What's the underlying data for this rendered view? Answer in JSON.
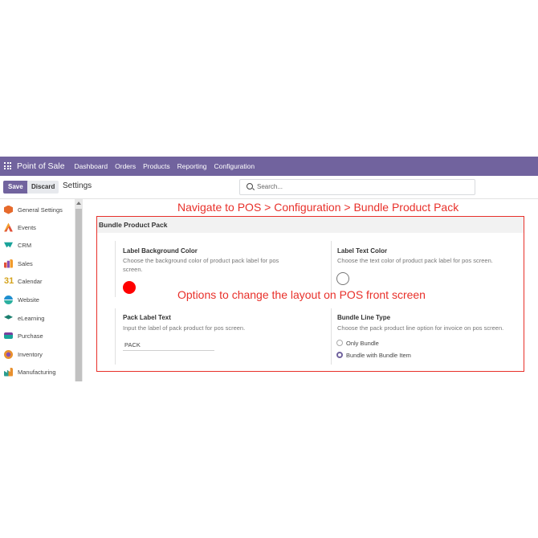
{
  "topnav": {
    "app_name": "Point of Sale",
    "items": [
      "Dashboard",
      "Orders",
      "Products",
      "Reporting",
      "Configuration"
    ],
    "color": "#71639e"
  },
  "control_panel": {
    "save_label": "Save",
    "discard_label": "Discard",
    "title": "Settings",
    "search_placeholder": "Search..."
  },
  "sidebar": {
    "items": [
      {
        "label": "General Settings",
        "icon": "gear-cube-icon",
        "color": "#e66a2c"
      },
      {
        "label": "Events",
        "icon": "events-icon",
        "color": "#f29b2c"
      },
      {
        "label": "CRM",
        "icon": "crm-handshake-icon",
        "color": "#1aa39a"
      },
      {
        "label": "Sales",
        "icon": "sales-chart-icon",
        "color": "#8a4fb5"
      },
      {
        "label": "Calendar",
        "icon": "calendar-31-icon",
        "color": "#d4a21a"
      },
      {
        "label": "Website",
        "icon": "website-globe-icon",
        "color": "#1f8fcf"
      },
      {
        "label": "eLearning",
        "icon": "elearning-cap-icon",
        "color": "#1b7f6e"
      },
      {
        "label": "Purchase",
        "icon": "purchase-card-icon",
        "color": "#7a3e9d"
      },
      {
        "label": "Inventory",
        "icon": "inventory-box-icon",
        "color": "#e8902e"
      },
      {
        "label": "Manufacturing",
        "icon": "manufacturing-icon",
        "color": "#2a9d8f"
      }
    ]
  },
  "section": {
    "title": "Bundle Product Pack",
    "label_bg": {
      "title": "Label Background Color",
      "desc": "Choose the background color of product pack label for pos screen.",
      "color": "#ff0000"
    },
    "label_text": {
      "title": "Label Text Color",
      "desc": "Choose the text color of product pack label for pos screen.",
      "color": "#ffffff"
    },
    "pack_label": {
      "title": "Pack Label Text",
      "desc": "Input the label of pack product for pos screen.",
      "value": "PACK"
    },
    "bundle_line": {
      "title": "Bundle Line Type",
      "desc": "Choose the pack product line option for invoice on pos screen.",
      "options": [
        "Only Bundle",
        "Bundle with Bundle Item"
      ],
      "selected": "Bundle with Bundle Item"
    }
  },
  "annotations": {
    "top": "Navigate to POS > Configuration > Bundle Product Pack",
    "middle": "Options to change the layout on POS front screen",
    "color": "#e8302a"
  }
}
